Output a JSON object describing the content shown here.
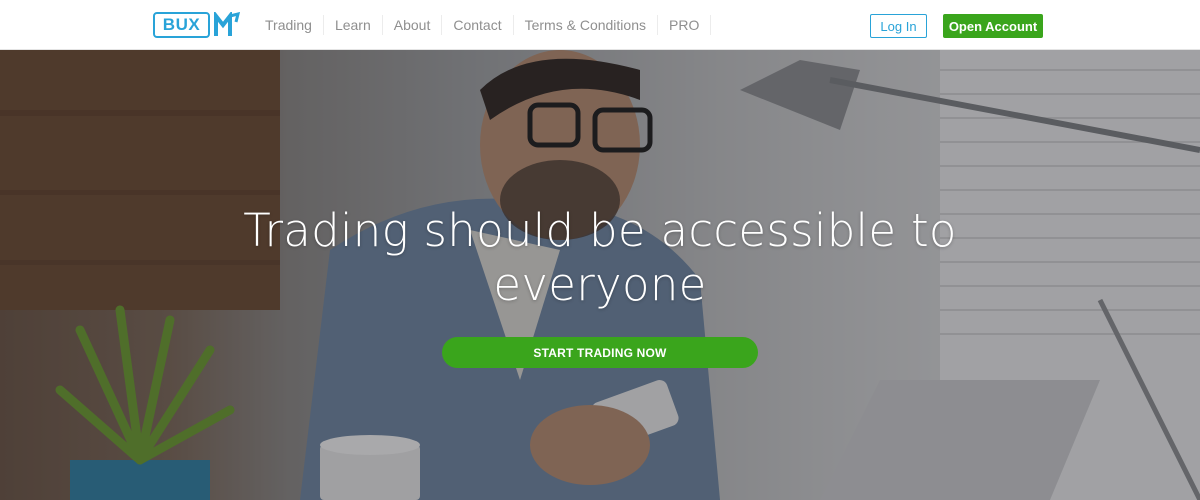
{
  "brand": {
    "logo_text": "BUX",
    "logo_icon": "bux-m-mark-icon",
    "accent_color": "#29a3d8",
    "action_color": "#3aa51c"
  },
  "nav": {
    "items": [
      {
        "label": "Trading"
      },
      {
        "label": "Learn"
      },
      {
        "label": "About"
      },
      {
        "label": "Contact"
      },
      {
        "label": "Terms & Conditions"
      },
      {
        "label": "PRO"
      }
    ]
  },
  "header": {
    "login_label": "Log In",
    "open_account_label": "Open Account"
  },
  "hero": {
    "title_line1": "Trading should be accessible to",
    "title_line2": "everyone",
    "cta_label": "START TRADING NOW",
    "background_image": "man-with-phone-at-desk-photo"
  }
}
